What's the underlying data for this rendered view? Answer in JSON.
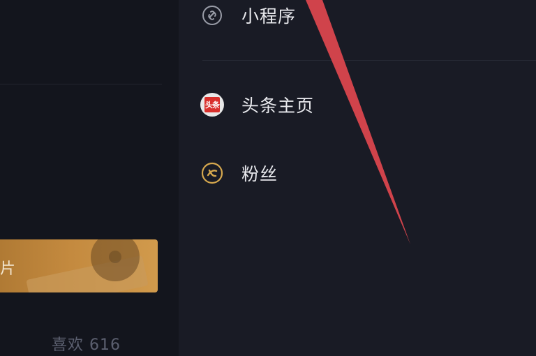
{
  "left": {
    "banner_text": "片",
    "likes": "喜欢 616"
  },
  "menu": {
    "items": [
      {
        "label": "小程序",
        "icon": "link-icon"
      },
      {
        "label": "头条主页",
        "icon": "toutiao-icon",
        "badge_text": "头条"
      },
      {
        "label": "粉丝",
        "icon": "fans-icon"
      }
    ]
  },
  "colors": {
    "background": "#161822",
    "accent_arrow": "#e0464e",
    "fans_icon": "#d6a84e",
    "toutiao_red": "#d9302c"
  }
}
